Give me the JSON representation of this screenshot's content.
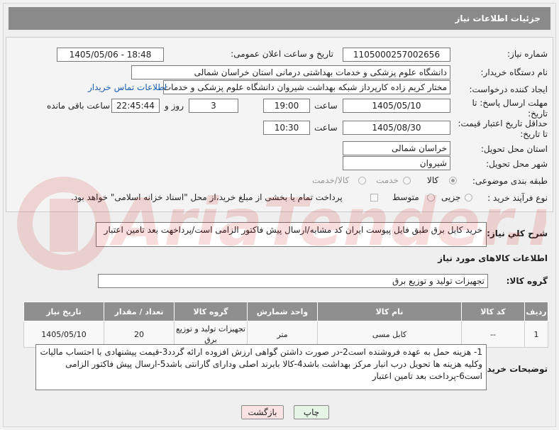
{
  "header": {
    "title": "جزئیات اطلاعات نیاز"
  },
  "labels": {
    "need_number": "شماره نیاز:",
    "announce_datetime": "تاریخ و ساعت اعلان عمومی:",
    "buyer_org": "نام دستگاه خریدار:",
    "requester": "ایجاد کننده درخواست:",
    "reply_deadline": "مهلت ارسال پاسخ: تا تاریخ:",
    "price_validity": "حداقل تاریخ اعتبار قیمت: تا تاریخ:",
    "delivery_province": "استان محل تحویل:",
    "delivery_city": "شهر محل تحویل:",
    "category": "طبقه بندی موضوعی:",
    "purchase_type": "نوع فرآیند خرید :",
    "time": "ساعت",
    "day_and": "روز و",
    "remaining": "ساعت باقی مانده",
    "general_desc": "شرح کلي نياز:",
    "goods_info": "اطلاعات کالاهای مورد نیاز",
    "goods_group": "گروه کالا:",
    "buyer_notes": "توضیحات خریدار:"
  },
  "fields": {
    "need_number": "1105000257002656",
    "announce_datetime": "1405/05/06 - 18:48",
    "buyer_org": "دانشگاه علوم پزشکی و خدمات بهداشتی درمانی استان خراسان شمالی",
    "requester": "مختار کریم زاده کارپرداز شبکه بهداشت شیروان دانشگاه علوم پزشکی و خدمات",
    "contact_link": "اطلاعات تماس خریدار",
    "reply_date": "1405/05/10",
    "reply_time": "19:00",
    "reply_days": "3",
    "reply_remaining": "22:45:44",
    "validity_date": "1405/08/30",
    "validity_time": "10:30",
    "province": "خراسان شمالی",
    "city": "شیروان"
  },
  "category_options": [
    {
      "label": "کالا",
      "selected": true
    },
    {
      "label": "خدمت",
      "selected": false
    },
    {
      "label": "کالا/خدمت",
      "selected": false
    }
  ],
  "purchase_options": [
    {
      "label": "جزیی",
      "selected": false
    },
    {
      "label": "متوسط",
      "selected": false
    }
  ],
  "treasury_note": "پرداخت تمام یا بخشی از مبلغ خرید،از محل \"اسناد خزانه اسلامی\" خواهد بود.",
  "general_description": "خرید کابل برق طبق فایل پیوست ایران کد مشابه/ارسال پیش فاکتور الزامی است/پرداخهت بعد تامین اعتبار",
  "goods_group_value": "تجهیزات تولید و توزیع برق",
  "table": {
    "headers": [
      "ردیف",
      "کد کالا",
      "نام کالا",
      "واحد شمارش",
      "گروه کالا",
      "تعداد / مقدار",
      "تاریخ نیاز"
    ],
    "rows": [
      [
        "1",
        "--",
        "کابل مسی",
        "متر",
        "تجهیزات تولید و توزیع برق",
        "20",
        "1405/05/10"
      ]
    ]
  },
  "buyer_notes_text": "1- هزینه حمل به عهده فروشنده است2-در صورت داشتن گواهی ارزش افزوده ارائه گردد3-قیمت پیشنهادی با احتساب مالیات وکلیه هزینه ها تحویل درب انبار مرکز بهداشت  باشد4-کالا بابرند اصلی ودارای گارانتی  باشد5-ارسال پیش فاکتور الزامی است6-پرداخت بعد تامین اعتبار",
  "buttons": {
    "print": "چاپ",
    "back": "بازگشت"
  },
  "watermark_text": "AriaTender.neT",
  "colors": {
    "header_bg": "#8a8a8a",
    "link": "#1a5fb4",
    "print_bg": "#e6f4e6",
    "back_bg": "#fbe3e3"
  }
}
